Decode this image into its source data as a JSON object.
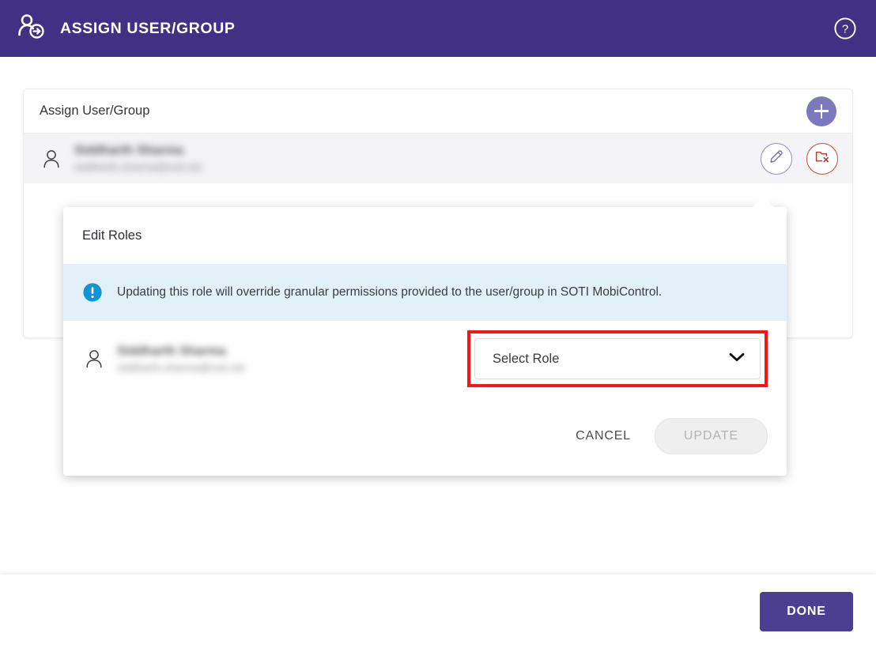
{
  "appbar": {
    "title": "ASSIGN USER/GROUP",
    "user_add_icon": "user-add-icon",
    "help_icon": "help-circle-icon",
    "background_color": "#413184"
  },
  "card": {
    "title": "Assign User/Group",
    "add_button_icon": "plus-icon",
    "add_button_color": "#7b79bb",
    "rows": [
      {
        "avatar_icon": "user-icon",
        "name": "Siddharth Sharma",
        "email": "siddharth.sharma@soti.net",
        "edit_icon": "pencil-icon",
        "remove_icon": "folder-remove-icon",
        "edit_color": "#8e8cc6",
        "remove_color": "#c94a3c"
      }
    ]
  },
  "popover": {
    "title": "Edit Roles",
    "banner": {
      "icon": "info-exclamation-icon",
      "text": "Updating this role will override granular permissions provided to the user/group in SOTI MobiControl.",
      "background_color": "#e2f1f8",
      "icon_color": "#1095d0"
    },
    "role_row": {
      "avatar_icon": "user-icon",
      "name": "Siddharth Sharma",
      "email": "siddharth.sharma@soti.net",
      "select": {
        "value": "Select Role",
        "chevron_icon": "chevron-down-icon",
        "highlight_color": "#f51616"
      }
    },
    "cancel_label": "CANCEL",
    "update_label": "UPDATE"
  },
  "footer": {
    "done_label": "DONE",
    "done_color": "#4c3f91"
  }
}
